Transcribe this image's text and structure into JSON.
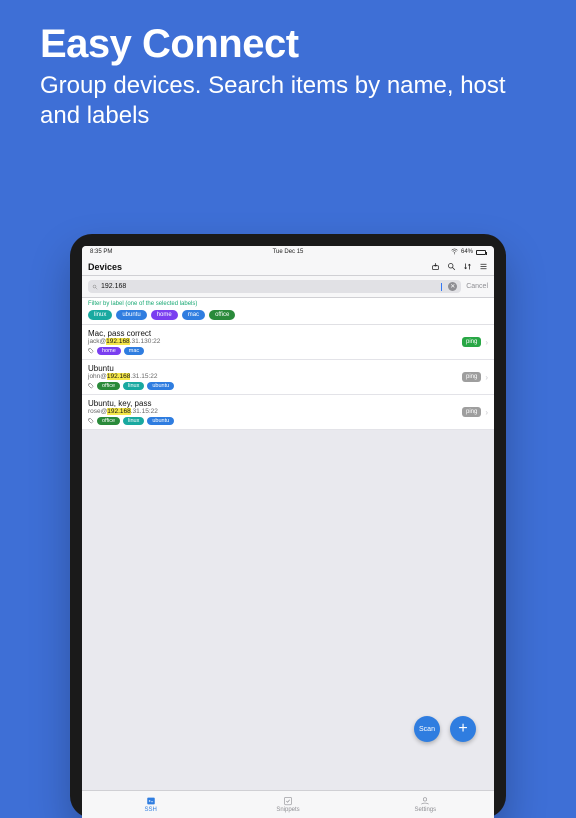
{
  "hero": {
    "title": "Easy Connect",
    "subtitle": "Group devices. Search items by name, host and labels"
  },
  "status": {
    "time": "8:35 PM",
    "date": "Tue Dec 15",
    "battery_pct": "64%"
  },
  "navbar": {
    "title": "Devices"
  },
  "search": {
    "value": "192.168",
    "cancel_label": "Cancel"
  },
  "filter": {
    "hint": "Filter by label (one of the selected labels)",
    "pills": [
      {
        "label": "linux",
        "color": "#19a9a0"
      },
      {
        "label": "ubuntu",
        "color": "#2f7de0"
      },
      {
        "label": "home",
        "color": "#7a3ef0"
      },
      {
        "label": "mac",
        "color": "#2f7de0"
      },
      {
        "label": "office",
        "color": "#2a8a3a"
      }
    ]
  },
  "devices": [
    {
      "name": "Mac, pass correct",
      "user": "jack@",
      "ip_hl": "192.168",
      "ip_rest": ".31.130:22",
      "tags": [
        {
          "label": "home",
          "color": "#7a3ef0"
        },
        {
          "label": "mac",
          "color": "#2f7de0"
        }
      ],
      "badge": {
        "label": "ping",
        "color": "#28a745"
      }
    },
    {
      "name": "Ubuntu",
      "user": "john@",
      "ip_hl": "192.168",
      "ip_rest": ".31.15:22",
      "tags": [
        {
          "label": "office",
          "color": "#2a8a3a"
        },
        {
          "label": "linux",
          "color": "#19a9a0"
        },
        {
          "label": "ubuntu",
          "color": "#2f7de0"
        }
      ],
      "badge": {
        "label": "ping",
        "color": "#9e9e9e"
      }
    },
    {
      "name": "Ubuntu, key, pass",
      "user": "rose@",
      "ip_hl": "192.168",
      "ip_rest": ".31.15:22",
      "tags": [
        {
          "label": "office",
          "color": "#2a8a3a"
        },
        {
          "label": "linux",
          "color": "#19a9a0"
        },
        {
          "label": "ubuntu",
          "color": "#2f7de0"
        }
      ],
      "badge": {
        "label": "ping",
        "color": "#9e9e9e"
      }
    }
  ],
  "fab": {
    "scan_label": "Scan",
    "plus_label": "+"
  },
  "tabs": {
    "ssh": "SSH",
    "snippets": "Snippets",
    "settings": "Settings"
  }
}
